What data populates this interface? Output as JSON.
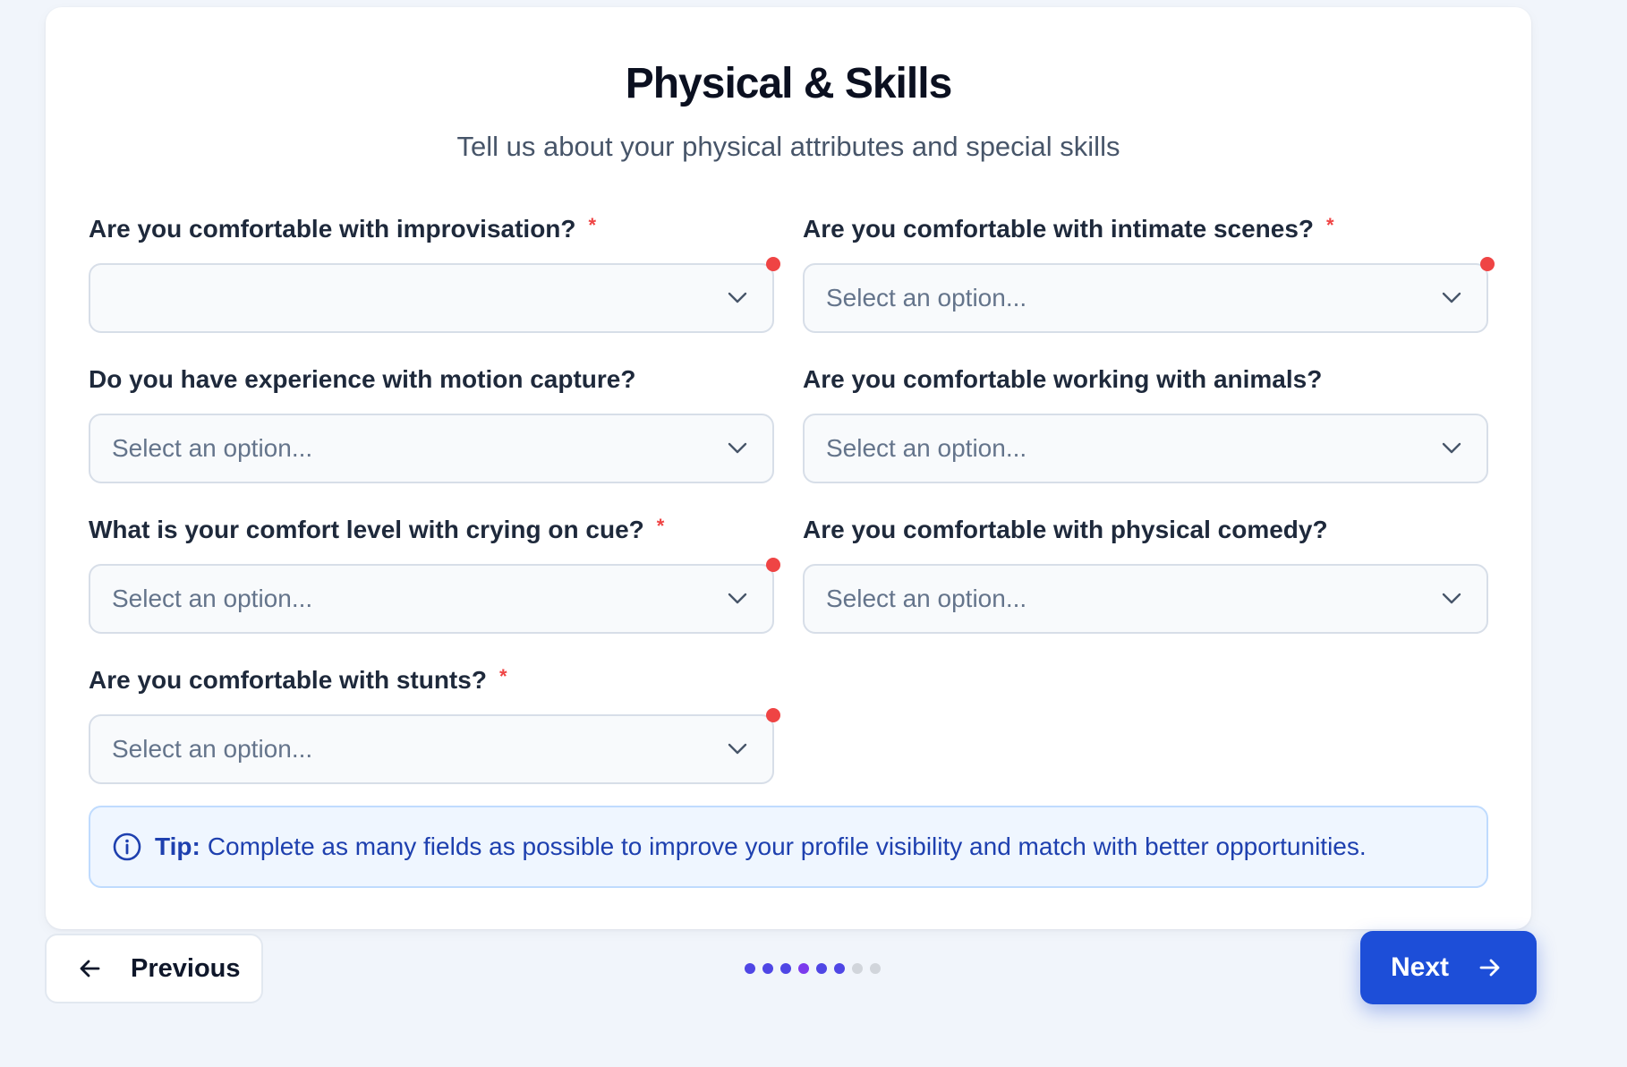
{
  "header": {
    "title": "Physical & Skills",
    "subtitle": "Tell us about your physical attributes and special skills"
  },
  "fields": [
    {
      "label": "Are you comfortable with improvisation?",
      "required": true,
      "value": "",
      "placeholder": "",
      "error": true
    },
    {
      "label": "Are you comfortable with intimate scenes?",
      "required": true,
      "value": "Select an option...",
      "error": true
    },
    {
      "label": "Do you have experience with motion capture?",
      "required": false,
      "value": "Select an option...",
      "error": false
    },
    {
      "label": "Are you comfortable working with animals?",
      "required": false,
      "value": "Select an option...",
      "error": false
    },
    {
      "label": "What is your comfort level with crying on cue?",
      "required": true,
      "value": "Select an option...",
      "error": true
    },
    {
      "label": "Are you comfortable with physical comedy?",
      "required": false,
      "value": "Select an option...",
      "error": false
    },
    {
      "label": "Are you comfortable with stunts?",
      "required": true,
      "value": "Select an option...",
      "error": true
    }
  ],
  "required_marker": "*",
  "tip": {
    "strong": "Tip:",
    "text": "Complete as many fields as possible to improve your profile visibility and match with better opportunities."
  },
  "navigation": {
    "previous_label": "Previous",
    "next_label": "Next",
    "steps_total": 8,
    "steps_completed": 6,
    "current_step": 6
  },
  "colors": {
    "primary": "#1d4ed8",
    "error": "#ef4444",
    "step_done": "#4f46e5",
    "step_pending": "#d1d5db",
    "tip_background": "#eff6ff"
  },
  "icons": {
    "select": "chevron-down-icon",
    "tip": "info-icon",
    "previous": "arrow-left-icon",
    "next": "arrow-right-icon"
  }
}
